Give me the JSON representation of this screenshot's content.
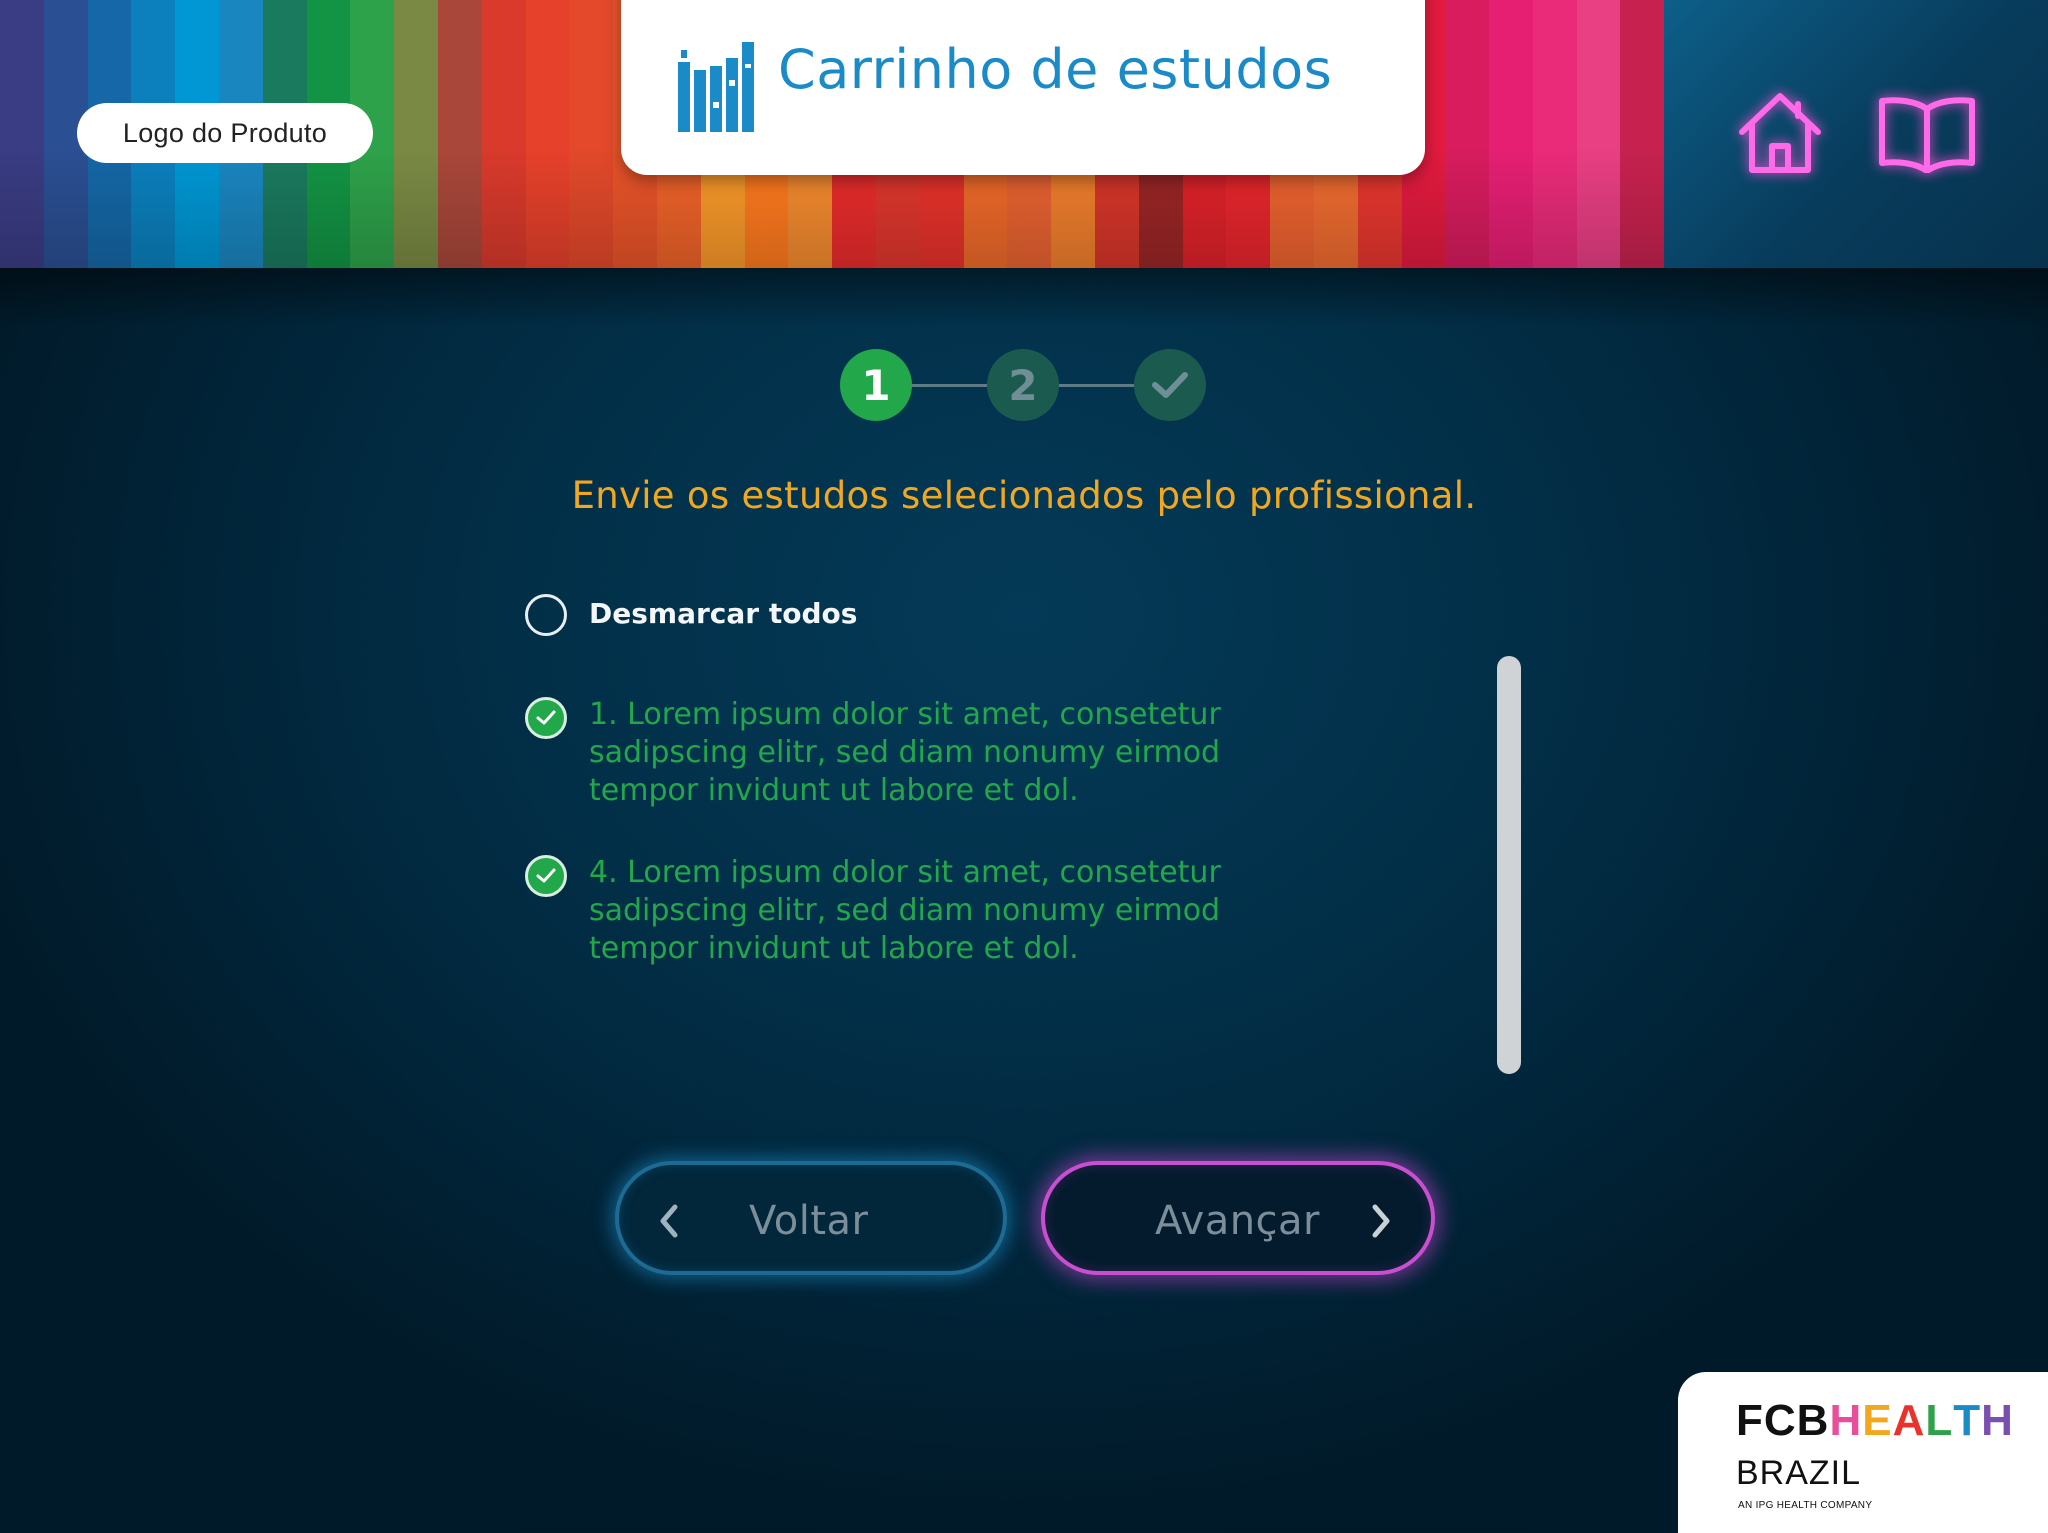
{
  "header": {
    "logo_label": "Logo do Produto",
    "title": "Carrinho de estudos",
    "stripe_colors": [
      "#3a3c84",
      "#2b4f93",
      "#1567a7",
      "#0b80bd",
      "#0097d4",
      "#1a86c0",
      "#1a7a5e",
      "#139444",
      "#2ea24a",
      "#7a8a44",
      "#a9473a",
      "#d93a2c",
      "#e6412b",
      "#e3492a",
      "#e95429",
      "#ef6329",
      "#f9992a",
      "#ff7a1f",
      "#f58b2f",
      "#ea2c2c",
      "#e0372d",
      "#e8322b",
      "#ef6a2a",
      "#e96331",
      "#f17f2d",
      "#d8362a",
      "#9b2626",
      "#e0222a",
      "#e9262d",
      "#ee6330",
      "#f06c30",
      "#e8372f",
      "#e31b3f",
      "#d81c5e",
      "#e61f73",
      "#ea2b79",
      "#e93f83",
      "#c7224f"
    ],
    "home_icon": "home-icon",
    "book_icon": "book-icon"
  },
  "stepper": {
    "steps": [
      {
        "label": "1",
        "state": "active"
      },
      {
        "label": "2",
        "state": "inactive"
      },
      {
        "label": "✓",
        "state": "inactive"
      }
    ]
  },
  "main": {
    "heading": "Envie os estudos selecionados pelo profissional.",
    "deselect_all_label": "Desmarcar todos",
    "studies": [
      {
        "text": "1. Lorem ipsum dolor sit amet, consetetur sadipscing elitr, sed diam nonumy eirmod tempor invidunt ut labore et dol.",
        "checked": true
      },
      {
        "text": "4. Lorem ipsum dolor sit amet, consetetur sadipscing elitr, sed diam nonumy eirmod tempor invidunt ut labore et dol.",
        "checked": true
      }
    ]
  },
  "nav": {
    "back_label": "Voltar",
    "next_label": "Avançar"
  },
  "footer": {
    "brand_fcb": "FCB",
    "brand_health": "HEALTH",
    "brand_country": "BRAZIL",
    "brand_tagline": "AN IPG HEALTH COMPANY"
  },
  "colors": {
    "accent_green": "#22a74a",
    "heading_orange": "#f2a81e",
    "title_blue": "#1a8bc6",
    "neon_pink": "#e94ee6",
    "neon_blue": "#1d6b93"
  }
}
